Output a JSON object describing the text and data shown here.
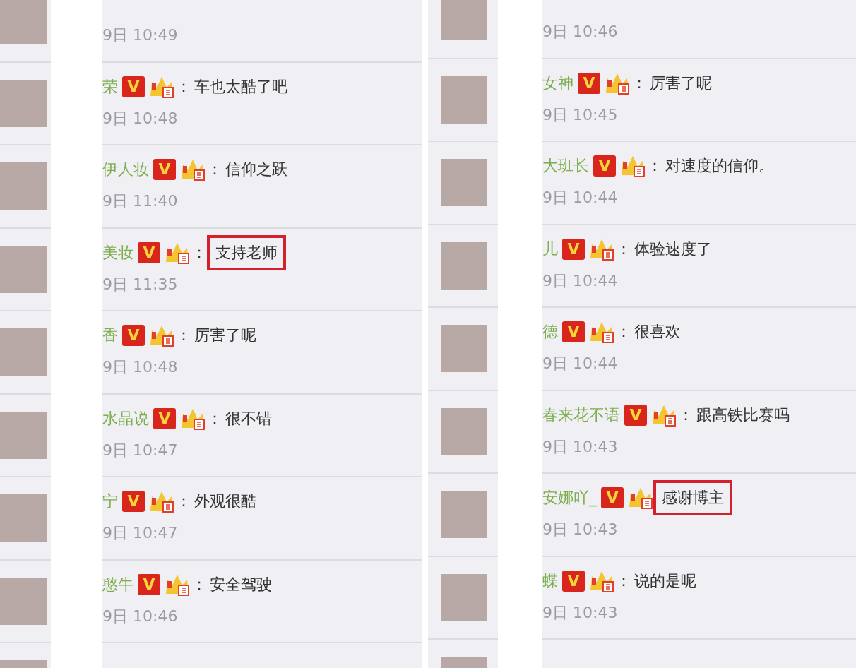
{
  "columns": [
    {
      "comments": [
        {
          "time": "9日 10:49"
        },
        {
          "name": "荣",
          "badge": "V",
          "separator": "：",
          "text": "车也太酷了吧",
          "time": "9日 10:48",
          "highlighted": false
        },
        {
          "name": "伊人妆",
          "badge": "V",
          "separator": "：",
          "text": "信仰之跃",
          "time": "9日 11:40",
          "highlighted": false
        },
        {
          "name": "美妆",
          "badge": "V",
          "separator": "：",
          "text": "支持老师",
          "time": "9日 11:35",
          "highlighted": true
        },
        {
          "name": "香",
          "badge": "V",
          "separator": "：",
          "text": "厉害了呢",
          "time": "9日 10:48",
          "highlighted": false
        },
        {
          "name": "水晶说",
          "badge": "V",
          "separator": "：",
          "text": "很不错",
          "time": "9日 10:47",
          "highlighted": false
        },
        {
          "name": "宁",
          "badge": "V",
          "separator": "：",
          "text": "外观很酷",
          "time": "9日 10:47",
          "highlighted": false
        },
        {
          "name": "憨牛",
          "badge": "V",
          "separator": "：",
          "text": "安全驾驶",
          "time": "9日 10:46",
          "highlighted": false
        }
      ]
    },
    {
      "comments": [
        {
          "time": "9日 10:46"
        },
        {
          "name": "女神",
          "badge": "V",
          "separator": "：",
          "text": "厉害了呢",
          "time": "9日 10:45",
          "highlighted": false
        },
        {
          "name": "大班长",
          "badge": "V",
          "separator": "：",
          "text": "对速度的信仰。",
          "time": "9日 10:44",
          "highlighted": false
        },
        {
          "name": "儿",
          "badge": "V",
          "separator": "：",
          "text": "体验速度了",
          "time": "9日 10:44",
          "highlighted": false
        },
        {
          "name": "德",
          "badge": "V",
          "separator": "：",
          "text": "很喜欢",
          "time": "9日 10:44",
          "highlighted": false
        },
        {
          "name": "春来花不语",
          "badge": "V",
          "separator": "：",
          "text": "跟高铁比赛吗",
          "time": "9日 10:43",
          "highlighted": false
        },
        {
          "name": "安娜吖_",
          "badge": "V",
          "text": "感谢博主",
          "time": "9日 10:43",
          "highlighted": true
        },
        {
          "name": "蝶",
          "badge": "V",
          "separator": "：",
          "text": "说的是呢",
          "time": "9日 10:43",
          "highlighted": false
        }
      ]
    }
  ]
}
